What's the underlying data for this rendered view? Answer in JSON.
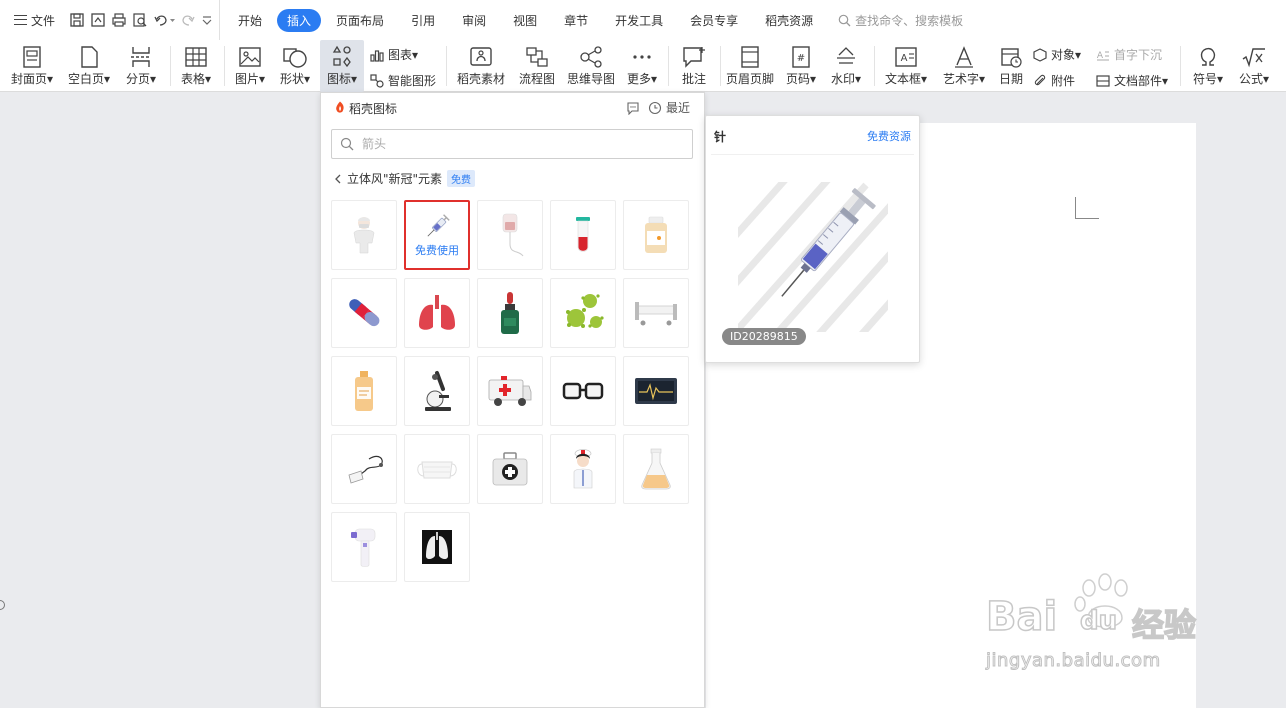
{
  "menubar": {
    "file_label": "文件",
    "tabs": [
      {
        "label": "开始"
      },
      {
        "label": "插入"
      },
      {
        "label": "页面布局"
      },
      {
        "label": "引用"
      },
      {
        "label": "审阅"
      },
      {
        "label": "视图"
      },
      {
        "label": "章节"
      },
      {
        "label": "开发工具"
      },
      {
        "label": "会员专享"
      },
      {
        "label": "稻壳资源"
      }
    ],
    "active_tab": "插入",
    "search_placeholder": "查找命令、搜索模板"
  },
  "ribbon": {
    "cover_page": "封面页",
    "blank_page": "空白页",
    "page_break": "分页",
    "table": "表格",
    "picture": "图片",
    "shape": "形状",
    "icon": "图标",
    "chart": "图表",
    "smart_graphic": "智能图形",
    "docer_material": "稻壳素材",
    "flowchart": "流程图",
    "mind_map": "思维导图",
    "more": "更多",
    "comment": "批注",
    "header_footer": "页眉页脚",
    "page_number": "页码",
    "watermark": "水印",
    "text_box": "文本框",
    "word_art": "艺术字",
    "date": "日期",
    "object": "对象",
    "attachment": "附件",
    "drop_cap": "首字下沉",
    "doc_parts": "文档部件",
    "symbol": "符号",
    "formula": "公式"
  },
  "icon_panel": {
    "title": "稻壳图标",
    "recent_label": "最近",
    "search_placeholder": "箭头",
    "breadcrumb": "立体风\"新冠\"元素",
    "free_tag": "免费",
    "free_use_label": "免费使用",
    "icons": [
      "doctor-icon",
      "syringe-icon",
      "iv-drip-icon",
      "test-tube-icon",
      "medicine-bottle-icon",
      "capsule-icon",
      "lungs-icon",
      "dropper-bottle-icon",
      "virus-icon",
      "hospital-bed-icon",
      "syrup-bottle-icon",
      "microscope-icon",
      "ambulance-icon",
      "goggles-icon",
      "monitor-icon",
      "stethoscope-icon",
      "face-mask-icon",
      "first-aid-kit-icon",
      "nurse-icon",
      "flask-icon",
      "thermometer-gun-icon",
      "xray-icon"
    ]
  },
  "preview": {
    "title": "针",
    "link": "免费资源",
    "id": "ID20289815"
  },
  "watermark": {
    "brand": "Bai",
    "brand2": "du",
    "cn": "经验",
    "url": "jingyan.baidu.com"
  }
}
